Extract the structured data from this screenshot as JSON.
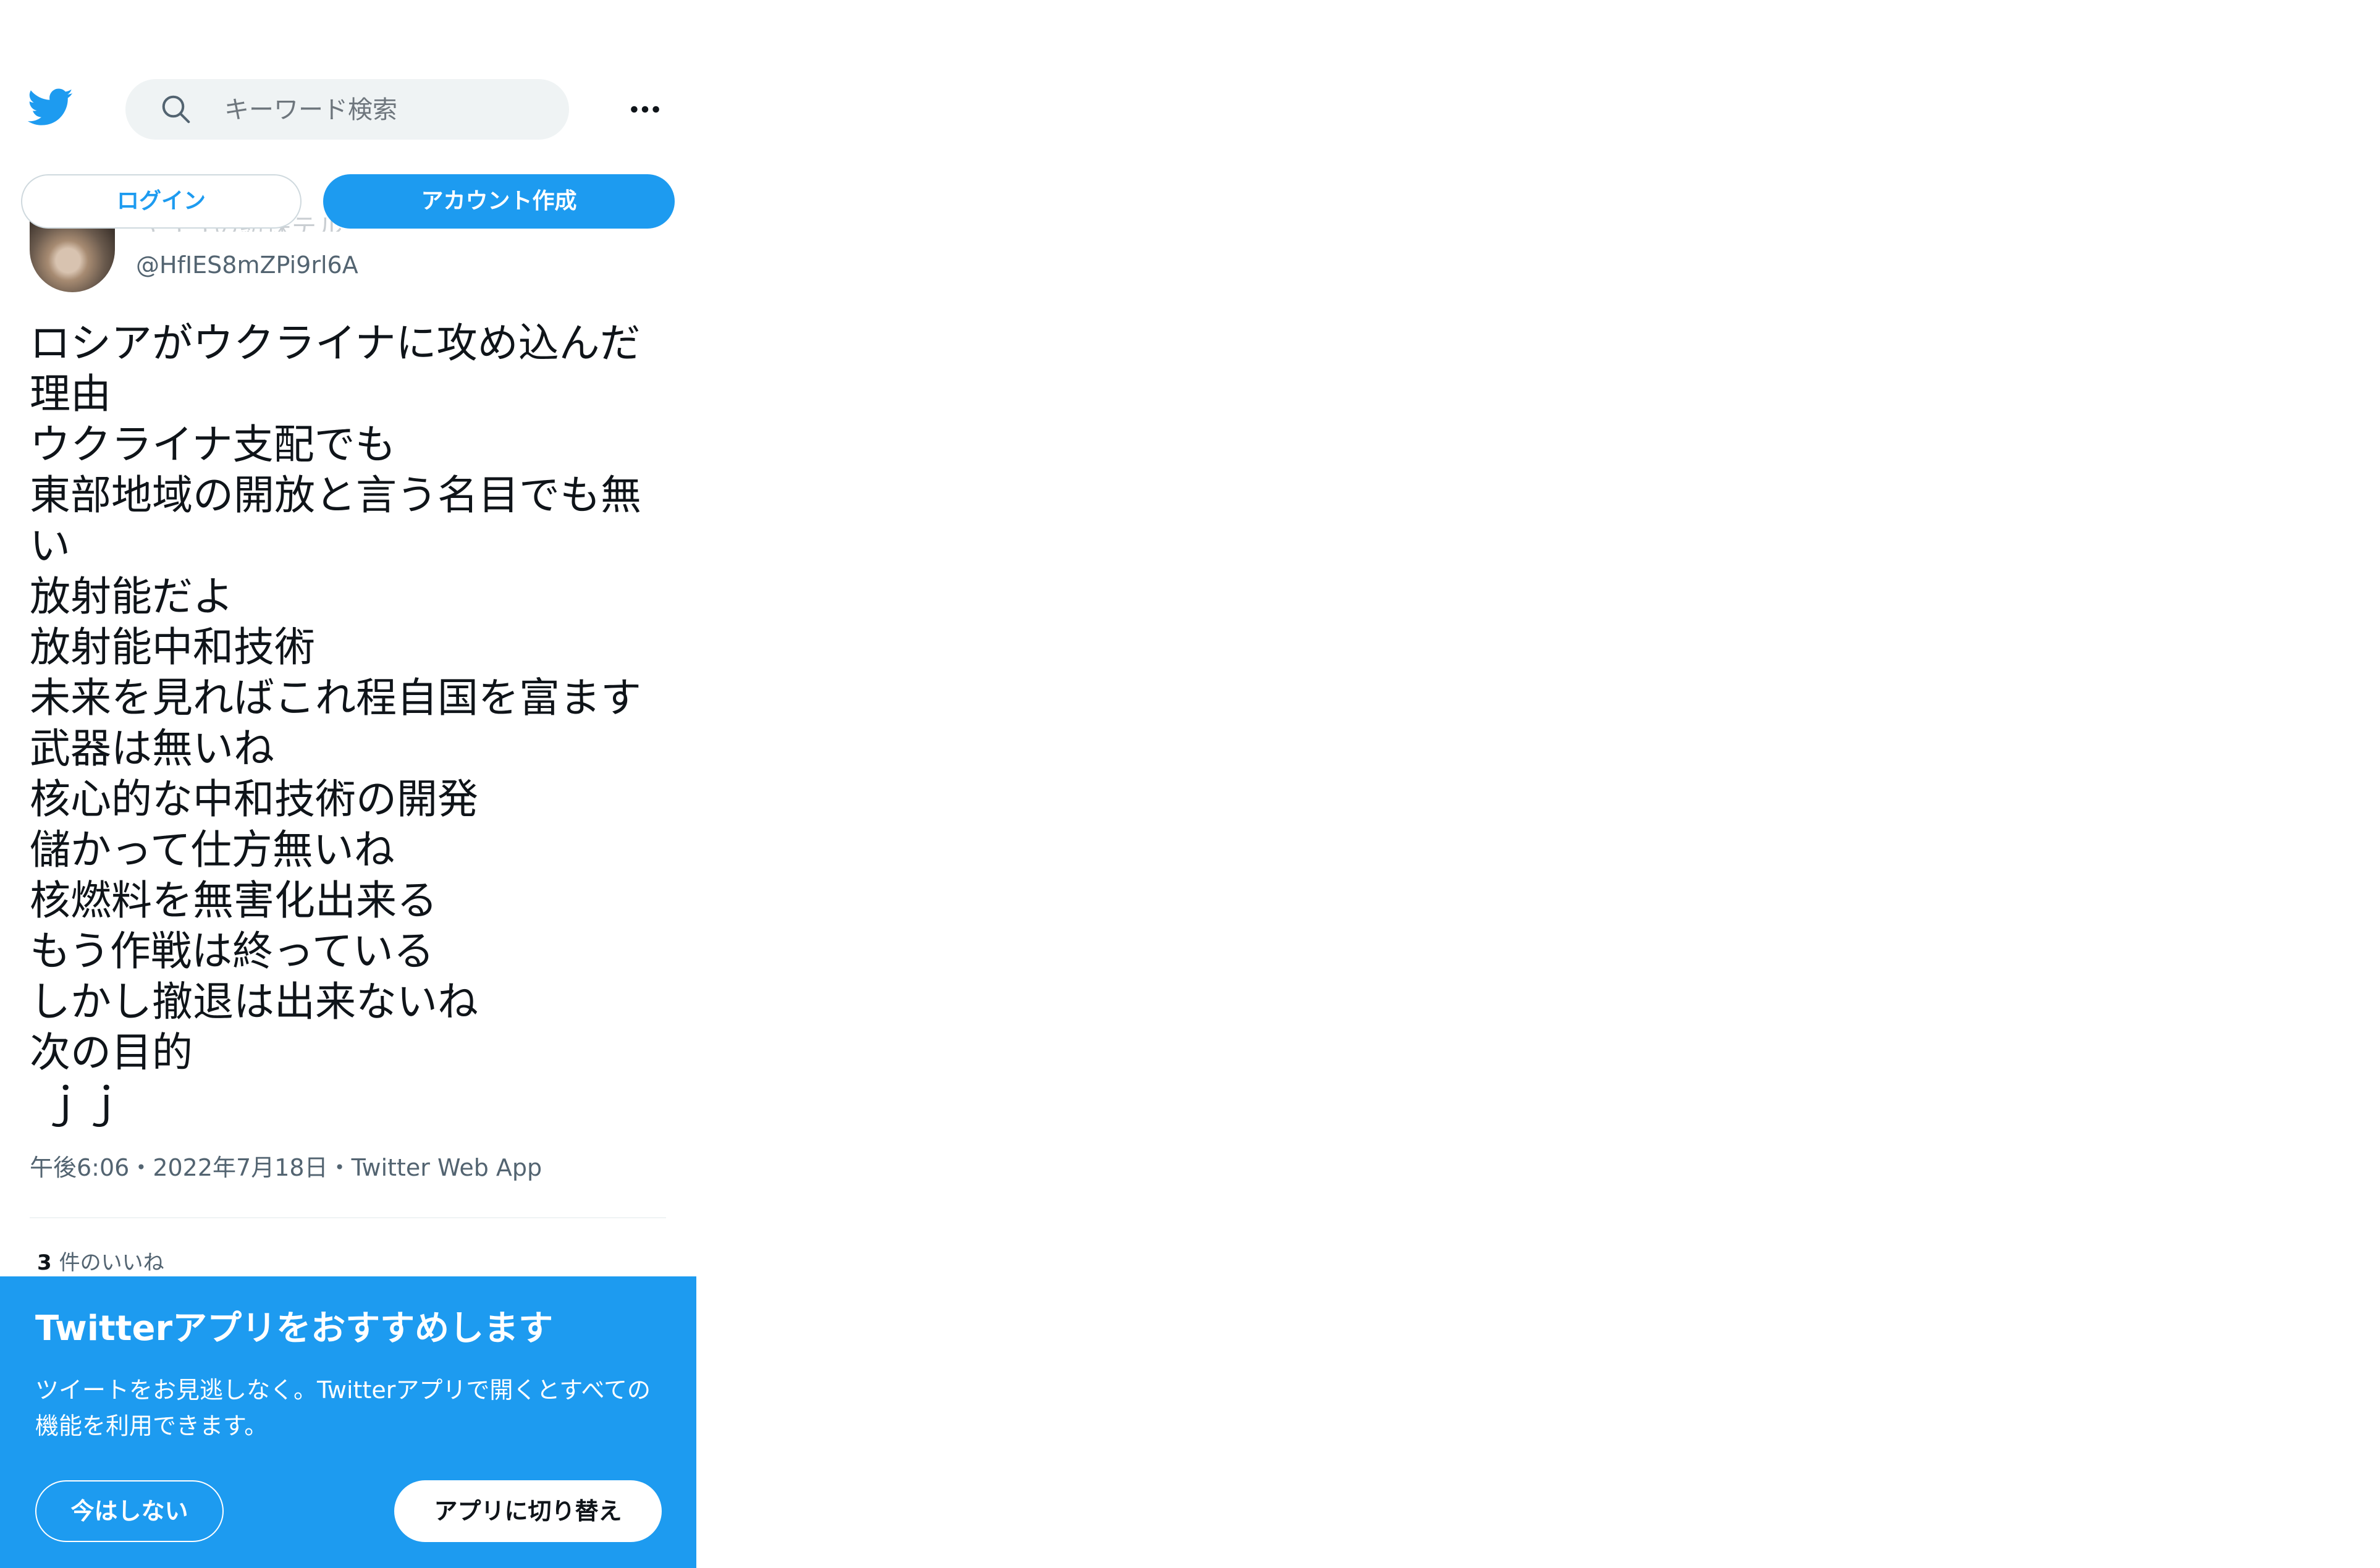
{
  "header": {
    "logo_icon": "twitter-bird-icon",
    "search_icon": "search-icon",
    "search_placeholder": "キーワード検索",
    "more_icon": "more-horizontal-icon",
    "login_label": "ログイン",
    "signup_label": "アカウント作成"
  },
  "colors": {
    "brand": "#1d9bf0",
    "text": "#0f1419",
    "secondary_text": "#536471"
  },
  "tweet": {
    "display_name": "３５５の紡珠テル",
    "handle": "@HfIES8mZPi9rl6A",
    "body": "ロシアがウクライナに攻め込んだ理由\nウクライナ支配でも\n東部地域の開放と言う名目でも無い\n放射能だよ\n放射能中和技術\n未来を見ればこれ程自国を富ます\n武器は無いね\n核心的な中和技術の開発\n儲かって仕方無いね\n核燃料を無害化出来る\nもう作戦は終っている\nしかし撤退は出来ないね\n次の目的\n ｊｊ",
    "meta": "午後6:06・2022年7月18日・Twitter Web App",
    "likes_count": "3",
    "likes_label": "件のいいね"
  },
  "banner": {
    "title": "Twitterアプリをおすすめします",
    "description": "ツイートをお見逃しなく。Twitterアプリで開くとすべての機能を利用できます。",
    "not_now_label": "今はしない",
    "switch_label": "アプリに切り替え"
  }
}
